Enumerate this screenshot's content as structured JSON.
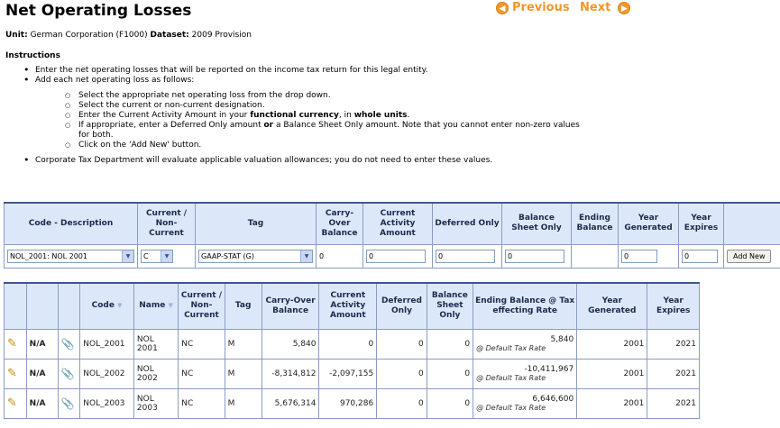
{
  "page": {
    "title": "Net Operating Losses",
    "previous_label": "Previous",
    "next_label": "Next"
  },
  "context": {
    "unit_label": "Unit:",
    "unit_value": "German Corporation (F1000)",
    "dataset_label": "Dataset:",
    "dataset_value": "2009 Provision"
  },
  "instructions": {
    "heading": "Instructions",
    "b1": "Enter the net operating losses that will be reported on the income tax return for this legal entity.",
    "b2": "Add each net operating loss as follows:",
    "s1": "Select the appropriate net operating loss from the drop down.",
    "s2": "Select the current or non-current designation.",
    "s3a": "Enter the Current Activity Amount in your ",
    "s3b": "functional currency",
    "s3c": ", in ",
    "s3d": "whole units",
    "s3e": ".",
    "s4a": "If appropriate, enter a Deferred Only amount ",
    "s4b": "or",
    "s4c": " a Balance Sheet Only amount. Note that you cannot enter non-zero values",
    "s4d": "for both.",
    "s5": "Click on the 'Add New' button.",
    "b3": "Corporate Tax Department will evaluate applicable valuation allowances; you do not need to enter these values."
  },
  "entry": {
    "headers": {
      "code": "Code - Description",
      "current": "Current / Non-Current",
      "tag": "Tag",
      "carry": "Carry-Over Balance",
      "activity": "Current Activity Amount",
      "deferred": "Deferred Only",
      "bs": "Balance Sheet Only",
      "ending": "Ending Balance",
      "ygen": "Year Generated",
      "yexp": "Year Expires"
    },
    "code_selected": "NOL_2001: NOL 2001",
    "current_selected": "C",
    "tag_selected": "GAAP-STAT (G)",
    "carry_value": "0",
    "activity_value": "0",
    "deferred_value": "0",
    "bs_value": "0",
    "ygen_value": "0",
    "yexp_value": "0",
    "add_label": "Add New"
  },
  "table": {
    "headers": {
      "code": "Code",
      "name": "Name",
      "current": "Current / Non-Current",
      "tag": "Tag",
      "carry": "Carry-Over Balance",
      "activity": "Current Activity Amount",
      "deferred": "Deferred Only",
      "bs": "Balance Sheet Only",
      "ending": "Ending Balance @ Tax effecting Rate",
      "ygen": "Year Generated",
      "yexp": "Year Expires"
    },
    "rows": [
      {
        "na": "N/A",
        "code": "NOL_2001",
        "name": "NOL 2001",
        "current": "NC",
        "tag": "M",
        "carry": "5,840",
        "activity": "0",
        "deferred": "0",
        "bs": "0",
        "ending": "5,840",
        "rate": "@ Default Tax Rate",
        "ygen": "2001",
        "yexp": "2021"
      },
      {
        "na": "N/A",
        "code": "NOL_2002",
        "name": "NOL 2002",
        "current": "NC",
        "tag": "M",
        "carry": "-8,314,812",
        "activity": "-2,097,155",
        "deferred": "0",
        "bs": "0",
        "ending": "-10,411,967",
        "rate": "@ Default Tax Rate",
        "ygen": "2001",
        "yexp": "2021"
      },
      {
        "na": "N/A",
        "code": "NOL_2003",
        "name": "NOL 2003",
        "current": "NC",
        "tag": "M",
        "carry": "5,676,314",
        "activity": "970,286",
        "deferred": "0",
        "bs": "0",
        "ending": "6,646,600",
        "rate": "@ Default Tax Rate",
        "ygen": "2001",
        "yexp": "2021"
      }
    ]
  }
}
